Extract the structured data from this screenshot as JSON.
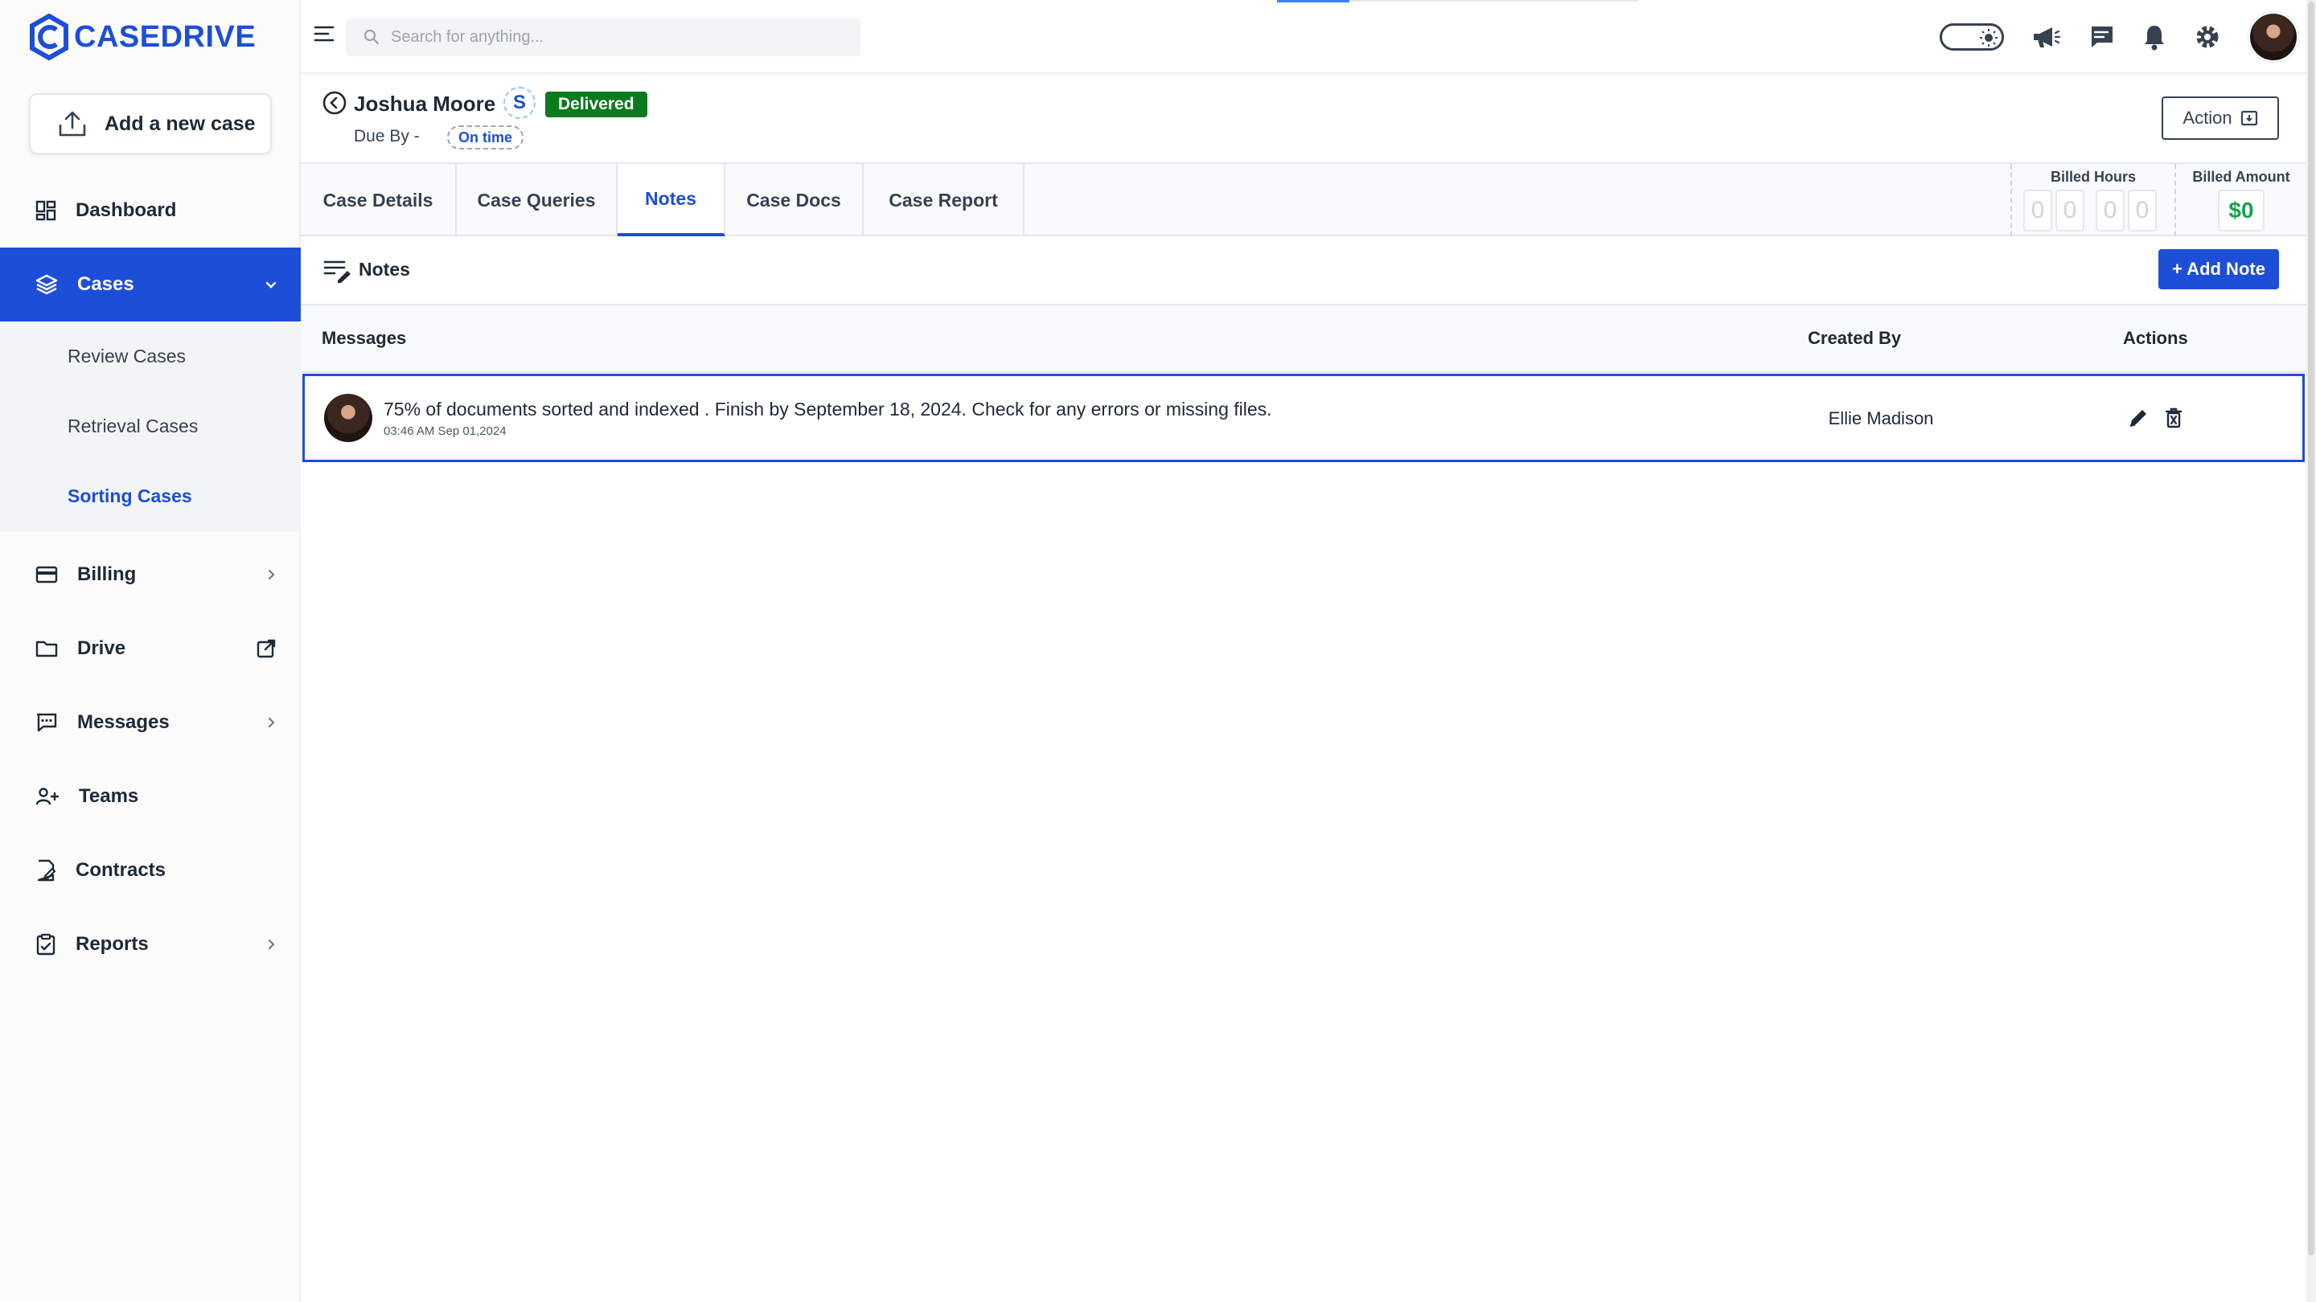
{
  "brand": {
    "name": "CASEDRIVE",
    "color": "#1d4ed8"
  },
  "sidebar": {
    "add_case_label": "Add a new case",
    "items": [
      {
        "label": "Dashboard",
        "icon": "dashboard-icon"
      },
      {
        "label": "Cases",
        "icon": "layers-icon",
        "active": true
      },
      {
        "label": "Billing",
        "icon": "credit-card-icon"
      },
      {
        "label": "Drive",
        "icon": "folder-icon"
      },
      {
        "label": "Messages",
        "icon": "chat-icon"
      },
      {
        "label": "Teams",
        "icon": "users-icon"
      },
      {
        "label": "Contracts",
        "icon": "contract-icon"
      },
      {
        "label": "Reports",
        "icon": "clipboard-icon"
      }
    ],
    "sub_items": [
      {
        "label": "Review Cases"
      },
      {
        "label": "Retrieval Cases"
      },
      {
        "label": "Sorting Cases",
        "active": true
      }
    ]
  },
  "topbar": {
    "search_placeholder": "Search for anything..."
  },
  "case": {
    "name": "Joshua Moore",
    "type_letter": "S",
    "status": "Delivered",
    "status_color": "#0b7a1f",
    "due_label": "Due By -",
    "due_status": "On time",
    "action_label": "Action"
  },
  "tabs": [
    {
      "label": "Case Details"
    },
    {
      "label": "Case Queries"
    },
    {
      "label": "Notes",
      "active": true
    },
    {
      "label": "Case Docs"
    },
    {
      "label": "Case Report"
    }
  ],
  "billing": {
    "hours_label": "Billed Hours",
    "hours_digits": [
      "0",
      "0",
      "0",
      "0"
    ],
    "amount_label": "Billed Amount",
    "amount_value": "$0"
  },
  "notes": {
    "title": "Notes",
    "add_label": "+ Add Note",
    "columns": {
      "messages": "Messages",
      "created_by": "Created By",
      "actions": "Actions"
    },
    "rows": [
      {
        "message": "75% of documents sorted and indexed . Finish by September 18, 2024. Check for any errors or missing files.",
        "timestamp": "03:46 AM Sep 01,2024",
        "created_by": "Ellie Madison"
      }
    ]
  }
}
